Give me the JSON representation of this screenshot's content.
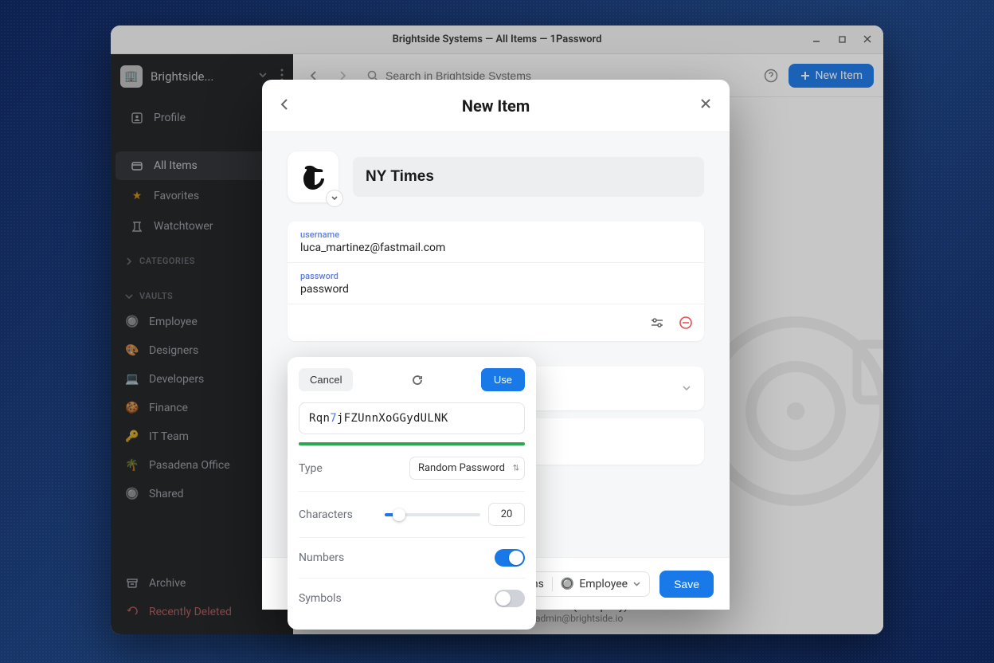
{
  "window": {
    "title": "Brightside Systems — All Items — 1Password"
  },
  "sidebar": {
    "org_name": "Brightside...",
    "nav": {
      "profile": "Profile",
      "all_items": "All Items",
      "favorites": "Favorites",
      "watchtower": "Watchtower"
    },
    "categories_label": "CATEGORIES",
    "vaults_label": "VAULTS",
    "vaults": {
      "employee": "Employee",
      "designers": "Designers",
      "developers": "Developers",
      "finance": "Finance",
      "it_team": "IT Team",
      "pasadena": "Pasadena Office",
      "shared": "Shared"
    },
    "bottom": {
      "archive": "Archive",
      "recent": "Recently Deleted"
    }
  },
  "toolbar": {
    "search_placeholder": "Search in Brightside Systems",
    "new_item": "New Item"
  },
  "background_item": {
    "title_fragment": "(Company)",
    "subtitle": "admin@brightside.io"
  },
  "modal": {
    "title": "New Item",
    "item_name": "NY Times",
    "username_label": "username",
    "username_value": "luca_martinez@fastmail.com",
    "password_label": "password",
    "password_value": "password",
    "footer": {
      "org": "Brightside Systems",
      "vault": "Employee",
      "save": "Save"
    }
  },
  "generator": {
    "cancel": "Cancel",
    "use": "Use",
    "value_pre": "Rqn",
    "value_digit": "7",
    "value_post": "jFZUnnXoGGydULNK",
    "type_label": "Type",
    "type_value": "Random Password",
    "characters_label": "Characters",
    "characters_value": "20",
    "numbers_label": "Numbers",
    "numbers_on": true,
    "symbols_label": "Symbols",
    "symbols_on": false
  }
}
